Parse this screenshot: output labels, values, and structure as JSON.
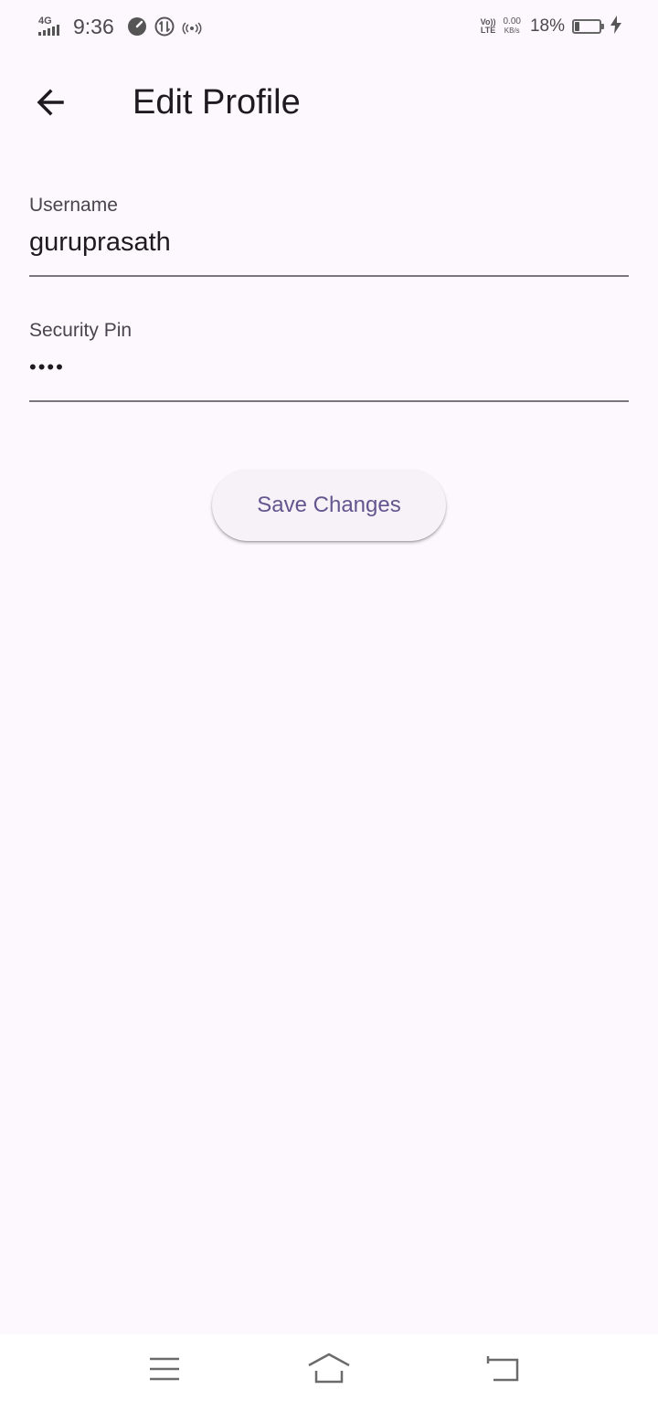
{
  "status_bar": {
    "network_type": "4G",
    "time": "9:36",
    "volte_top": "Vo))",
    "volte_bottom": "LTE",
    "speed_value": "0.00",
    "speed_unit": "KB/s",
    "battery_percent": "18%",
    "battery_level": 0.18,
    "icons": [
      "signal-icon",
      "speed-gauge-icon",
      "data-saver-icon",
      "hotspot-icon",
      "battery-icon",
      "charging-bolt-icon"
    ]
  },
  "app_bar": {
    "back_icon": "arrow-back-icon",
    "title": "Edit Profile"
  },
  "form": {
    "username": {
      "label": "Username",
      "value": "guruprasath"
    },
    "security_pin": {
      "label": "Security Pin",
      "masked_value": "••••"
    },
    "save_label": "Save Changes"
  },
  "nav_bar": {
    "icons": [
      "menu-icon",
      "home-icon",
      "back-nav-icon"
    ]
  },
  "colors": {
    "background": "#fdf7fe",
    "primary": "#65558f",
    "button_surface": "#f7f1f8",
    "underline": "#79747e",
    "label": "#49454f",
    "text": "#1d1b20"
  }
}
